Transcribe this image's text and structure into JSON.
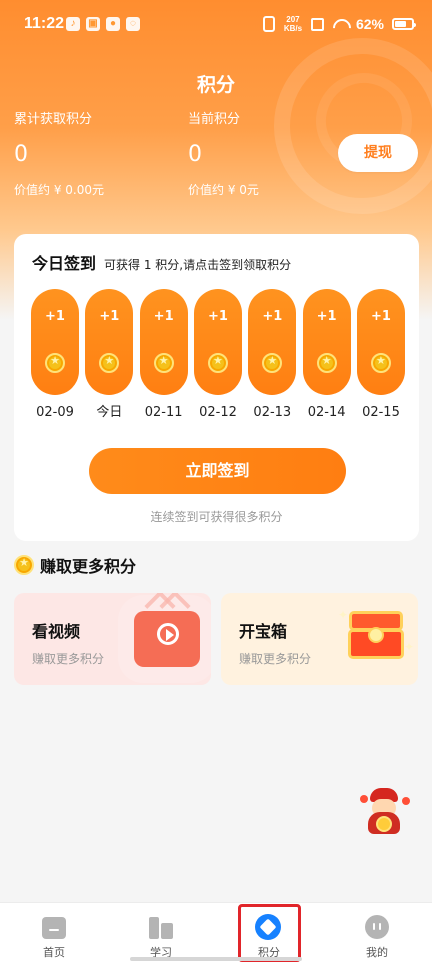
{
  "status_bar": {
    "time": "11:22",
    "network_speed_value": "207",
    "network_speed_unit": "KB/s",
    "battery": "62%",
    "icons": {
      "app_icon_1": "tiktok-icon",
      "app_icon_2": "box-icon",
      "app_icon_3": "brand-icon",
      "app_icon_4": "link-icon",
      "vibrate": "vibrate-icon",
      "sim": "sim-icon",
      "wifi": "wifi-icon",
      "battery": "battery-icon"
    }
  },
  "header": {
    "title": "积分"
  },
  "points_summary": {
    "total_label": "累计获取积分",
    "total_value": "0",
    "total_worth": "价值约 ¥ 0.00元",
    "current_label": "当前积分",
    "current_value": "0",
    "current_worth": "价值约 ¥ 0元",
    "withdraw_label": "提现"
  },
  "checkin": {
    "title": "今日签到",
    "subtitle": "可获得 1 积分,请点击签到领取积分",
    "days": [
      {
        "points": "+1",
        "label": "02-09"
      },
      {
        "points": "+1",
        "label": "今日"
      },
      {
        "points": "+1",
        "label": "02-11"
      },
      {
        "points": "+1",
        "label": "02-12"
      },
      {
        "points": "+1",
        "label": "02-13"
      },
      {
        "points": "+1",
        "label": "02-14"
      },
      {
        "points": "+1",
        "label": "02-15"
      }
    ],
    "button_label": "立即签到",
    "hint": "连续签到可获得很多积分"
  },
  "earn_more": {
    "title": "赚取更多积分",
    "cards": [
      {
        "title": "看视频",
        "subtitle": "赚取更多积分",
        "icon": "tv-icon"
      },
      {
        "title": "开宝箱",
        "subtitle": "赚取更多积分",
        "icon": "treasure-chest-icon"
      }
    ]
  },
  "bottom_nav": {
    "items": [
      {
        "label": "首页",
        "icon": "home-icon"
      },
      {
        "label": "学习",
        "icon": "study-icon"
      },
      {
        "label": "积分",
        "icon": "points-icon"
      },
      {
        "label": "我的",
        "icon": "profile-icon"
      }
    ],
    "selected": "积分"
  },
  "colors": {
    "brand_orange": "#ff8b1a",
    "selected_blue": "#1681ff",
    "highlight_red": "#e1252a"
  }
}
